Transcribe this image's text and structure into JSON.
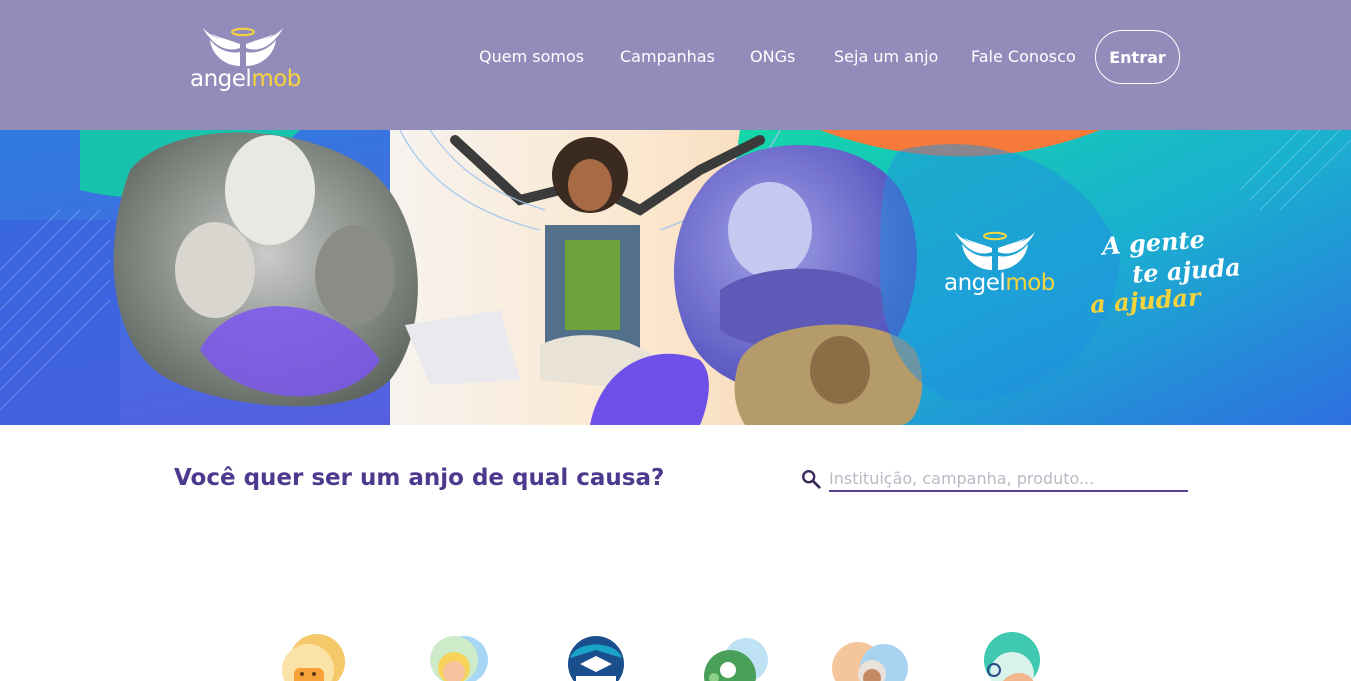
{
  "brand": {
    "name_part1": "angel",
    "name_part2": "mob",
    "colors": {
      "header": "#918cba",
      "accent_yellow": "#f7d43b",
      "primary_purple": "#4d3a8f",
      "teal": "#1ec8b0"
    }
  },
  "header": {
    "nav": [
      {
        "label": "Quem somos"
      },
      {
        "label": "Campanhas"
      },
      {
        "label": "ONGs"
      },
      {
        "label": "Seja um anjo"
      },
      {
        "label": "Fale Conosco"
      }
    ],
    "login_label": "Entrar"
  },
  "hero": {
    "tagline_line1": "A gente",
    "tagline_line2": "te ajuda",
    "tagline_line3": "a ajudar"
  },
  "search": {
    "question": "Você quer ser um anjo de qual causa?",
    "placeholder": "Instituição, campanha, produto...",
    "icon": "search-icon"
  },
  "causes": [
    {
      "icon": "animals-cause-icon"
    },
    {
      "icon": "children-cause-icon"
    },
    {
      "icon": "education-cause-icon"
    },
    {
      "icon": "environment-cause-icon"
    },
    {
      "icon": "elderly-cause-icon"
    },
    {
      "icon": "health-cause-icon"
    }
  ]
}
